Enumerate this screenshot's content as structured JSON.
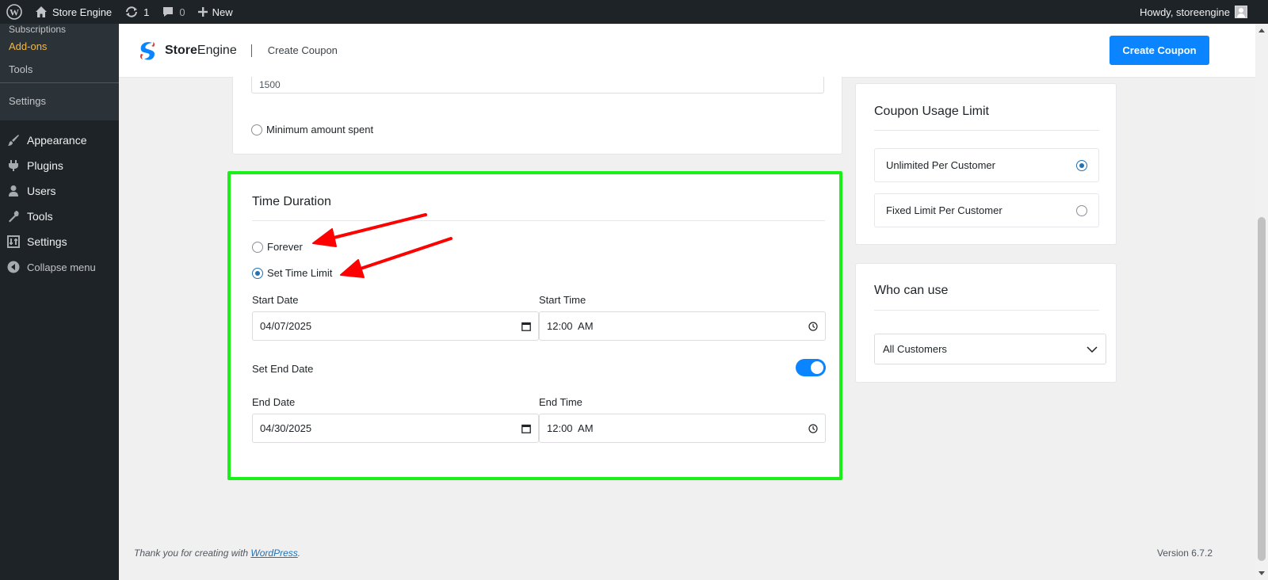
{
  "adminbar": {
    "site_name": "Store Engine",
    "updates_count": "1",
    "comments_count": "0",
    "new_label": "New",
    "howdy": "Howdy, storeengine"
  },
  "sidebar": {
    "submenu": [
      "Subscriptions",
      "Add-ons",
      "Tools",
      "Settings"
    ],
    "active_submenu": "Add-ons",
    "menu": [
      {
        "label": "Appearance",
        "icon": "paintbrush-icon"
      },
      {
        "label": "Plugins",
        "icon": "plugin-icon"
      },
      {
        "label": "Users",
        "icon": "user-icon"
      },
      {
        "label": "Tools",
        "icon": "wrench-icon"
      },
      {
        "label": "Settings",
        "icon": "settings-sliders-icon"
      }
    ],
    "collapse_label": "Collapse menu"
  },
  "header": {
    "brand_bold": "Store",
    "brand_rest": "Engine",
    "page_title": "Create Coupon",
    "create_button": "Create Coupon"
  },
  "min_requirements": {
    "amount_value": "1500",
    "option_minimum_amount": "Minimum amount spent"
  },
  "time_duration": {
    "title": "Time Duration",
    "option_forever": "Forever",
    "option_set_time_limit": "Set Time Limit",
    "selected": "Set Time Limit",
    "start_date_label": "Start Date",
    "start_date_value": "04/07/2025",
    "start_time_label": "Start Time",
    "start_time_value": "12:00  AM",
    "set_end_date_label": "Set End Date",
    "set_end_date_enabled": true,
    "end_date_label": "End Date",
    "end_date_value": "04/30/2025",
    "end_time_label": "End Time",
    "end_time_value": "12:00  AM"
  },
  "usage_limit": {
    "title": "Coupon Usage Limit",
    "options": [
      "Unlimited Per Customer",
      "Fixed Limit Per Customer"
    ],
    "selected": "Unlimited Per Customer"
  },
  "who_can_use": {
    "title": "Who can use",
    "selected": "All Customers"
  },
  "footer": {
    "thanks_prefix": "Thank you for creating with ",
    "wordpress_link": "WordPress",
    "thanks_suffix": ".",
    "version": "Version 6.7.2"
  },
  "colors": {
    "accent": "#0a84ff",
    "highlight_border": "#18f018",
    "annotation_arrow": "#ff0000",
    "admin_bg": "#1d2327"
  }
}
